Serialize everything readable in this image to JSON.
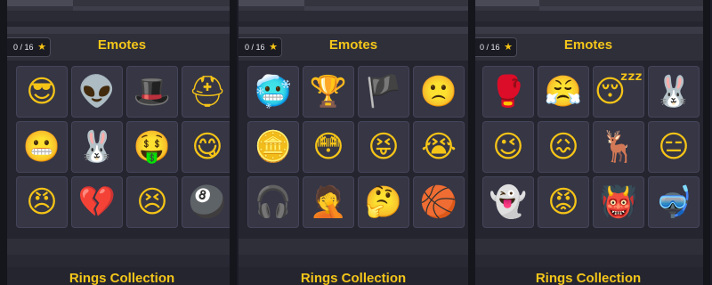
{
  "panels": [
    {
      "counter": "0 / 16",
      "title": "Emotes",
      "footer_title": "Rings Collection",
      "emotes": [
        {
          "icon": "emote-glasses-icon",
          "glyph": "😎"
        },
        {
          "icon": "emote-alien-icon",
          "glyph": "👽"
        },
        {
          "icon": "emote-tophat-icon",
          "glyph": "🎩"
        },
        {
          "icon": "emote-helmet-icon",
          "glyph": "⛑"
        },
        {
          "icon": "emote-nervous-icon",
          "glyph": "😬"
        },
        {
          "icon": "emote-magician-icon",
          "glyph": "🐰"
        },
        {
          "icon": "emote-money-icon",
          "glyph": "🤑"
        },
        {
          "icon": "emote-chef-icon",
          "glyph": "😋"
        },
        {
          "icon": "emote-ninja-icon",
          "glyph": "😠"
        },
        {
          "icon": "emote-broken-heart-icon",
          "glyph": "💔"
        },
        {
          "icon": "emote-angry-icon",
          "glyph": "😣"
        },
        {
          "icon": "emote-eight-ball-icon",
          "glyph": "🎱"
        }
      ]
    },
    {
      "counter": "0 / 16",
      "title": "Emotes",
      "footer_title": "Rings Collection",
      "emotes": [
        {
          "icon": "emote-frozen-icon",
          "glyph": "🥶"
        },
        {
          "icon": "emote-trophy-icon",
          "glyph": "🏆"
        },
        {
          "icon": "emote-pirate-icon",
          "glyph": "🏴"
        },
        {
          "icon": "emote-pirate-sad-icon",
          "glyph": "🙁"
        },
        {
          "icon": "emote-treasure-icon",
          "glyph": "🪙"
        },
        {
          "icon": "emote-shocked-icon",
          "glyph": "😳"
        },
        {
          "icon": "emote-cue-icon",
          "glyph": "😝"
        },
        {
          "icon": "emote-crying-icon",
          "glyph": "😭"
        },
        {
          "icon": "emote-headphones-icon",
          "glyph": "🎧"
        },
        {
          "icon": "emote-facepalm-icon",
          "glyph": "🤦"
        },
        {
          "icon": "emote-thinking-icon",
          "glyph": "🤔"
        },
        {
          "icon": "emote-basketball-icon",
          "glyph": "🏀"
        }
      ]
    },
    {
      "counter": "0 / 16",
      "title": "Emotes",
      "footer_title": "Rings Collection",
      "emotes": [
        {
          "icon": "emote-boxing-icon",
          "glyph": "🥊"
        },
        {
          "icon": "emote-headband-icon",
          "glyph": "😤"
        },
        {
          "icon": "emote-sleepy-icon",
          "glyph": "😴"
        },
        {
          "icon": "emote-bunny-icon",
          "glyph": "🐰"
        },
        {
          "icon": "emote-wink-icon",
          "glyph": "😉"
        },
        {
          "icon": "emote-scared-icon",
          "glyph": "😖"
        },
        {
          "icon": "emote-reindeer-icon",
          "glyph": "🦌"
        },
        {
          "icon": "emote-blindfold-icon",
          "glyph": "😑"
        },
        {
          "icon": "emote-ghost-icon",
          "glyph": "👻"
        },
        {
          "icon": "emote-headset-icon",
          "glyph": "😡"
        },
        {
          "icon": "emote-monster-icon",
          "glyph": "👹"
        },
        {
          "icon": "emote-diver-icon",
          "glyph": "🤿"
        }
      ]
    }
  ]
}
